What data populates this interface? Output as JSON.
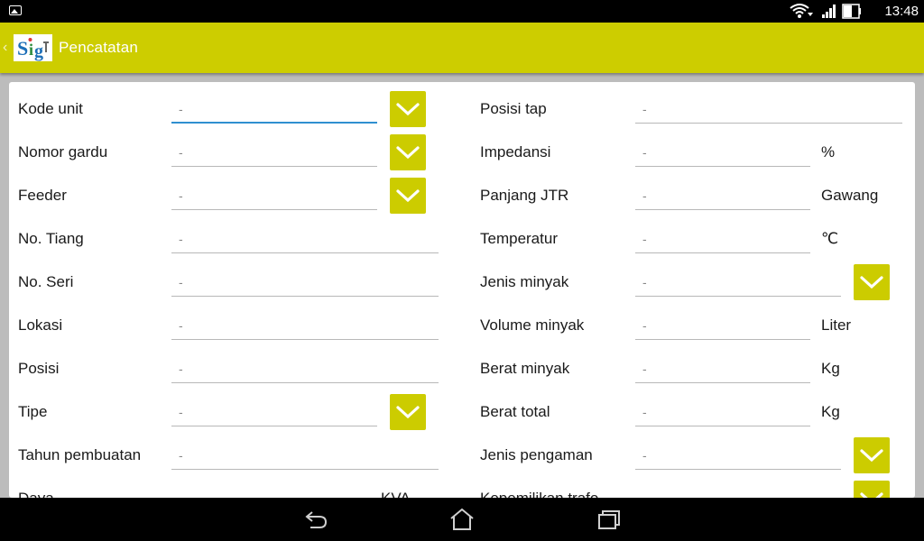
{
  "status_bar": {
    "time": "13:48"
  },
  "app_bar": {
    "title": "Pencatatan",
    "logo_text": "SiGi"
  },
  "placeholder": "-",
  "left_fields": [
    {
      "label": "Kode unit",
      "value": "-",
      "dropdown": true,
      "focused": true
    },
    {
      "label": "Nomor gardu",
      "value": "-",
      "dropdown": true
    },
    {
      "label": "Feeder",
      "value": "-",
      "dropdown": true
    },
    {
      "label": "No. Tiang",
      "value": "-"
    },
    {
      "label": "No. Seri",
      "value": "-"
    },
    {
      "label": "Lokasi",
      "value": "-"
    },
    {
      "label": "Posisi",
      "value": "-"
    },
    {
      "label": "Tipe",
      "value": "-",
      "dropdown": true
    },
    {
      "label": "Tahun pembuatan",
      "value": "-"
    },
    {
      "label": "Daya",
      "value": "-",
      "unit": "KVA"
    }
  ],
  "right_fields": [
    {
      "label": "Posisi tap",
      "value": "-"
    },
    {
      "label": "Impedansi",
      "value": "-",
      "unit": "%"
    },
    {
      "label": "Panjang JTR",
      "value": "-",
      "unit": "Gawang"
    },
    {
      "label": "Temperatur",
      "value": "-",
      "unit": "℃"
    },
    {
      "label": "Jenis minyak",
      "value": "-",
      "dropdown": true
    },
    {
      "label": "Volume minyak",
      "value": "-",
      "unit": "Liter"
    },
    {
      "label": "Berat minyak",
      "value": "-",
      "unit": "Kg"
    },
    {
      "label": "Berat total",
      "value": "-",
      "unit": "Kg"
    },
    {
      "label": "Jenis pengaman",
      "value": "-",
      "dropdown": true
    },
    {
      "label": "Kepemilikan trafo",
      "value": "-",
      "dropdown": true
    }
  ],
  "colors": {
    "accent": "#cdcd00",
    "button": "#cccc00",
    "focus": "#2f8fd0"
  },
  "icons": {
    "dropdown": "chevron-down-icon",
    "nav_back": "back-icon",
    "nav_home": "home-icon",
    "nav_recents": "recents-icon"
  }
}
